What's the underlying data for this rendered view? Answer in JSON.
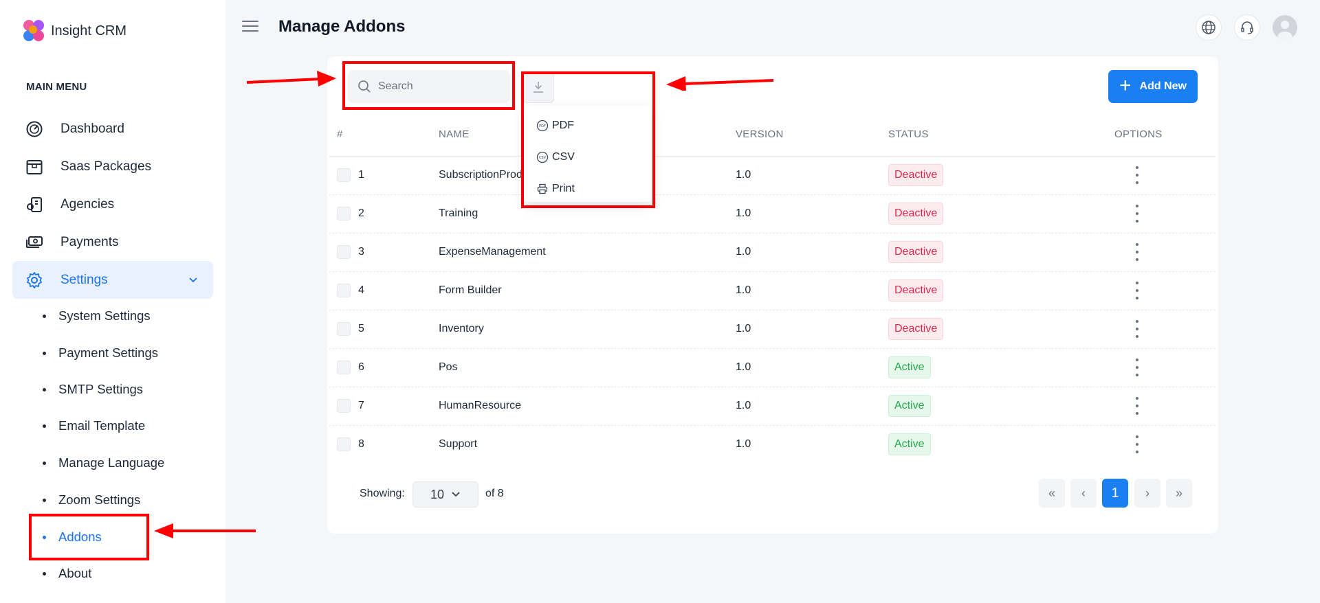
{
  "app": {
    "name": "Insight CRM"
  },
  "sidebar": {
    "heading": "MAIN MENU",
    "items": [
      {
        "label": "Dashboard",
        "icon": "dashboard-gauge-icon"
      },
      {
        "label": "Saas Packages",
        "icon": "package-icon"
      },
      {
        "label": "Agencies",
        "icon": "agencies-building-icon"
      },
      {
        "label": "Payments",
        "icon": "payments-cash-icon"
      },
      {
        "label": "Settings",
        "icon": "gear-icon",
        "active": true
      }
    ],
    "sub_items": [
      {
        "label": "System Settings"
      },
      {
        "label": "Payment Settings"
      },
      {
        "label": "SMTP Settings"
      },
      {
        "label": "Email Template"
      },
      {
        "label": "Manage Language"
      },
      {
        "label": "Zoom Settings"
      },
      {
        "label": "Addons",
        "active": true
      },
      {
        "label": "About"
      }
    ]
  },
  "header": {
    "title": "Manage Addons"
  },
  "toolbar": {
    "search_placeholder": "Search",
    "add_label": "Add New",
    "export_menu": [
      "PDF",
      "CSV",
      "Print"
    ]
  },
  "table": {
    "headers": [
      "#",
      "NAME",
      "VERSION",
      "STATUS",
      "OPTIONS"
    ],
    "rows": [
      {
        "id": "1",
        "name": "SubscriptionProd",
        "version": "1.0",
        "status": "Deactive"
      },
      {
        "id": "2",
        "name": "Training",
        "version": "1.0",
        "status": "Deactive"
      },
      {
        "id": "3",
        "name": "ExpenseManagement",
        "version": "1.0",
        "status": "Deactive"
      },
      {
        "id": "4",
        "name": "Form Builder",
        "version": "1.0",
        "status": "Deactive"
      },
      {
        "id": "5",
        "name": "Inventory",
        "version": "1.0",
        "status": "Deactive"
      },
      {
        "id": "6",
        "name": "Pos",
        "version": "1.0",
        "status": "Active"
      },
      {
        "id": "7",
        "name": "HumanResource",
        "version": "1.0",
        "status": "Active"
      },
      {
        "id": "8",
        "name": "Support",
        "version": "1.0",
        "status": "Active"
      }
    ]
  },
  "pagination": {
    "showing_label": "Showing:",
    "per_page": "10",
    "of_total": "of 8",
    "first": "«",
    "prev": "‹",
    "current": "1",
    "next": "›",
    "last": "»"
  },
  "colors": {
    "primary": "#1a7ff0",
    "active_nav_bg": "#e8f1fd",
    "deactive": "#e3264b",
    "active": "#20a94b",
    "annotation": "#ff0000"
  }
}
